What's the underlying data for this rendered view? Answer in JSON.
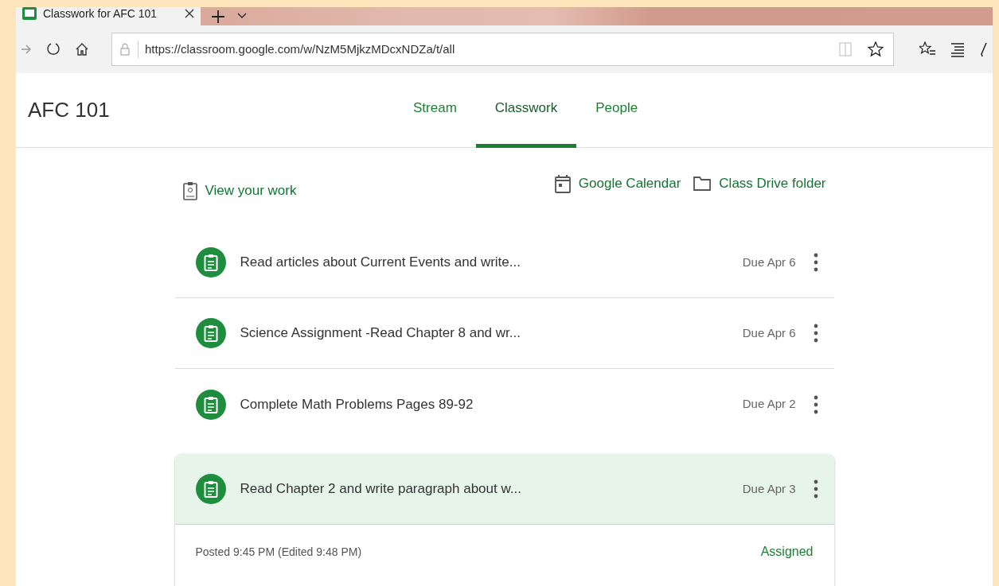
{
  "browser": {
    "tab_title": "Classwork for AFC 101",
    "url": "https://classroom.google.com/w/NzM5MjkzMDcxNDZa/t/all"
  },
  "class_name": "AFC 101",
  "tabs": [
    {
      "label": "Stream",
      "selected": false
    },
    {
      "label": "Classwork",
      "selected": true
    },
    {
      "label": "People",
      "selected": false
    }
  ],
  "links": {
    "view_work": "View your work",
    "calendar": "Google Calendar",
    "drive": "Class Drive folder"
  },
  "assignments": [
    {
      "title": "Read articles about Current Events and write...",
      "due": "Due Apr 6",
      "expanded": false
    },
    {
      "title": "Science Assignment -Read Chapter 8 and wr...",
      "due": "Due Apr 6",
      "expanded": false
    },
    {
      "title": "Complete Math Problems Pages 89-92",
      "due": "Due Apr 2",
      "expanded": false
    },
    {
      "title": "Read Chapter 2 and write paragraph about w...",
      "due": "Due Apr 3",
      "expanded": true,
      "posted": "Posted 9:45 PM (Edited 9:48 PM)",
      "status": "Assigned"
    }
  ]
}
